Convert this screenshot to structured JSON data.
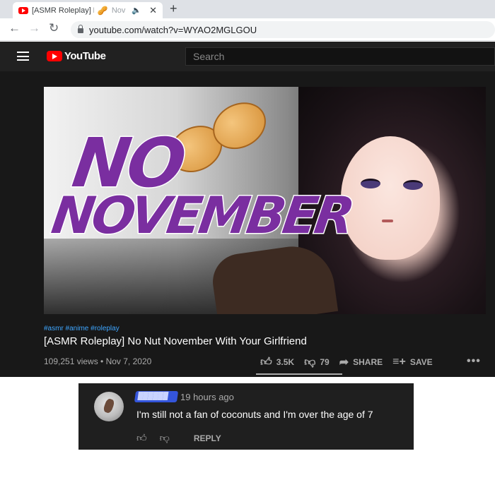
{
  "browser": {
    "tab": {
      "title": "[ASMR Roleplay] No",
      "title_tail": "Nov"
    },
    "url": "youtube.com/watch?v=WYAO2MGLGOU"
  },
  "youtube": {
    "logo_text": "YouTube",
    "search_placeholder": "Search",
    "thumbnail": {
      "line1": "NO",
      "line2": "NOVEMBER"
    },
    "video": {
      "tags": "#asmr #anime #roleplay",
      "title": "[ASMR Roleplay] No Nut November With Your Girlfriend",
      "stats": "109,251 views • Nov 7, 2020",
      "likes": "3.5K",
      "dislikes": "79",
      "share_label": "SHARE",
      "save_label": "SAVE"
    }
  },
  "comment": {
    "username": "██████",
    "time": "19 hours ago",
    "text": "I'm still not a fan of coconuts and I'm over the age of 7",
    "reply_label": "REPLY"
  },
  "colors": {
    "youtube_red": "#ff0000",
    "link_blue": "#3ea6ff",
    "thumb_purple": "#7a2ea0"
  },
  "icons": [
    "youtube-favicon-icon",
    "peanut-icon",
    "speaker-icon",
    "close-icon",
    "plus-icon",
    "back-arrow-icon",
    "forward-arrow-icon",
    "reload-icon",
    "lock-icon",
    "hamburger-menu-icon",
    "thumbs-up-icon",
    "thumbs-down-icon",
    "share-arrow-icon",
    "playlist-add-icon",
    "more-icon"
  ]
}
